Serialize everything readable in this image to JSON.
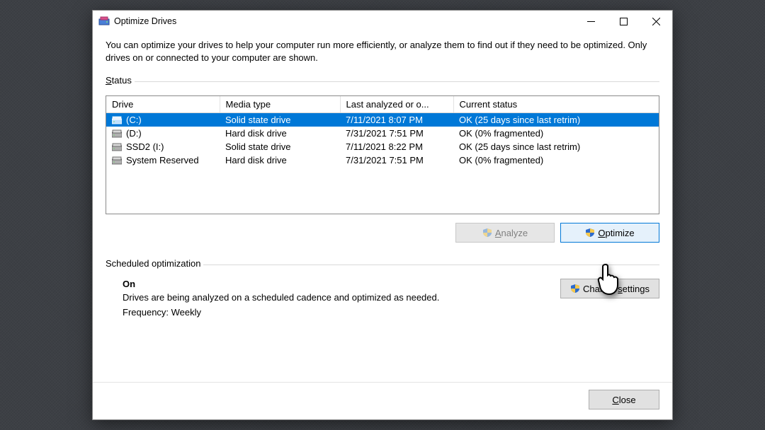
{
  "title": "Optimize Drives",
  "intro": "You can optimize your drives to help your computer run more efficiently, or analyze them to find out if they need to be optimized. Only drives on or connected to your computer are shown.",
  "status_label_prefix": "S",
  "status_label_rest": "tatus",
  "columns": {
    "drive": "Drive",
    "media": "Media type",
    "last": "Last analyzed or o...",
    "status": "Current status"
  },
  "drives": [
    {
      "name": "(C:)",
      "media": "Solid state drive",
      "last": "7/11/2021 8:07 PM",
      "status": "OK (25 days since last retrim)",
      "selected": true
    },
    {
      "name": "(D:)",
      "media": "Hard disk drive",
      "last": "7/31/2021 7:51 PM",
      "status": "OK (0% fragmented)",
      "selected": false
    },
    {
      "name": "SSD2 (I:)",
      "media": "Solid state drive",
      "last": "7/11/2021 8:22 PM",
      "status": "OK (25 days since last retrim)",
      "selected": false
    },
    {
      "name": "System Reserved",
      "media": "Hard disk drive",
      "last": "7/31/2021 7:51 PM",
      "status": "OK (0% fragmented)",
      "selected": false
    }
  ],
  "buttons": {
    "analyze_prefix": "A",
    "analyze_rest": "nalyze",
    "optimize_prefix": "O",
    "optimize_rest": "ptimize",
    "change_prefix": "Change ",
    "change_un": "s",
    "change_suffix": "ettings",
    "close_prefix": "",
    "close_un": "C",
    "close_suffix": "lose"
  },
  "schedule": {
    "heading": "Scheduled optimization",
    "on": "On",
    "desc": "Drives are being analyzed on a scheduled cadence and optimized as needed.",
    "freq": "Frequency: Weekly"
  }
}
